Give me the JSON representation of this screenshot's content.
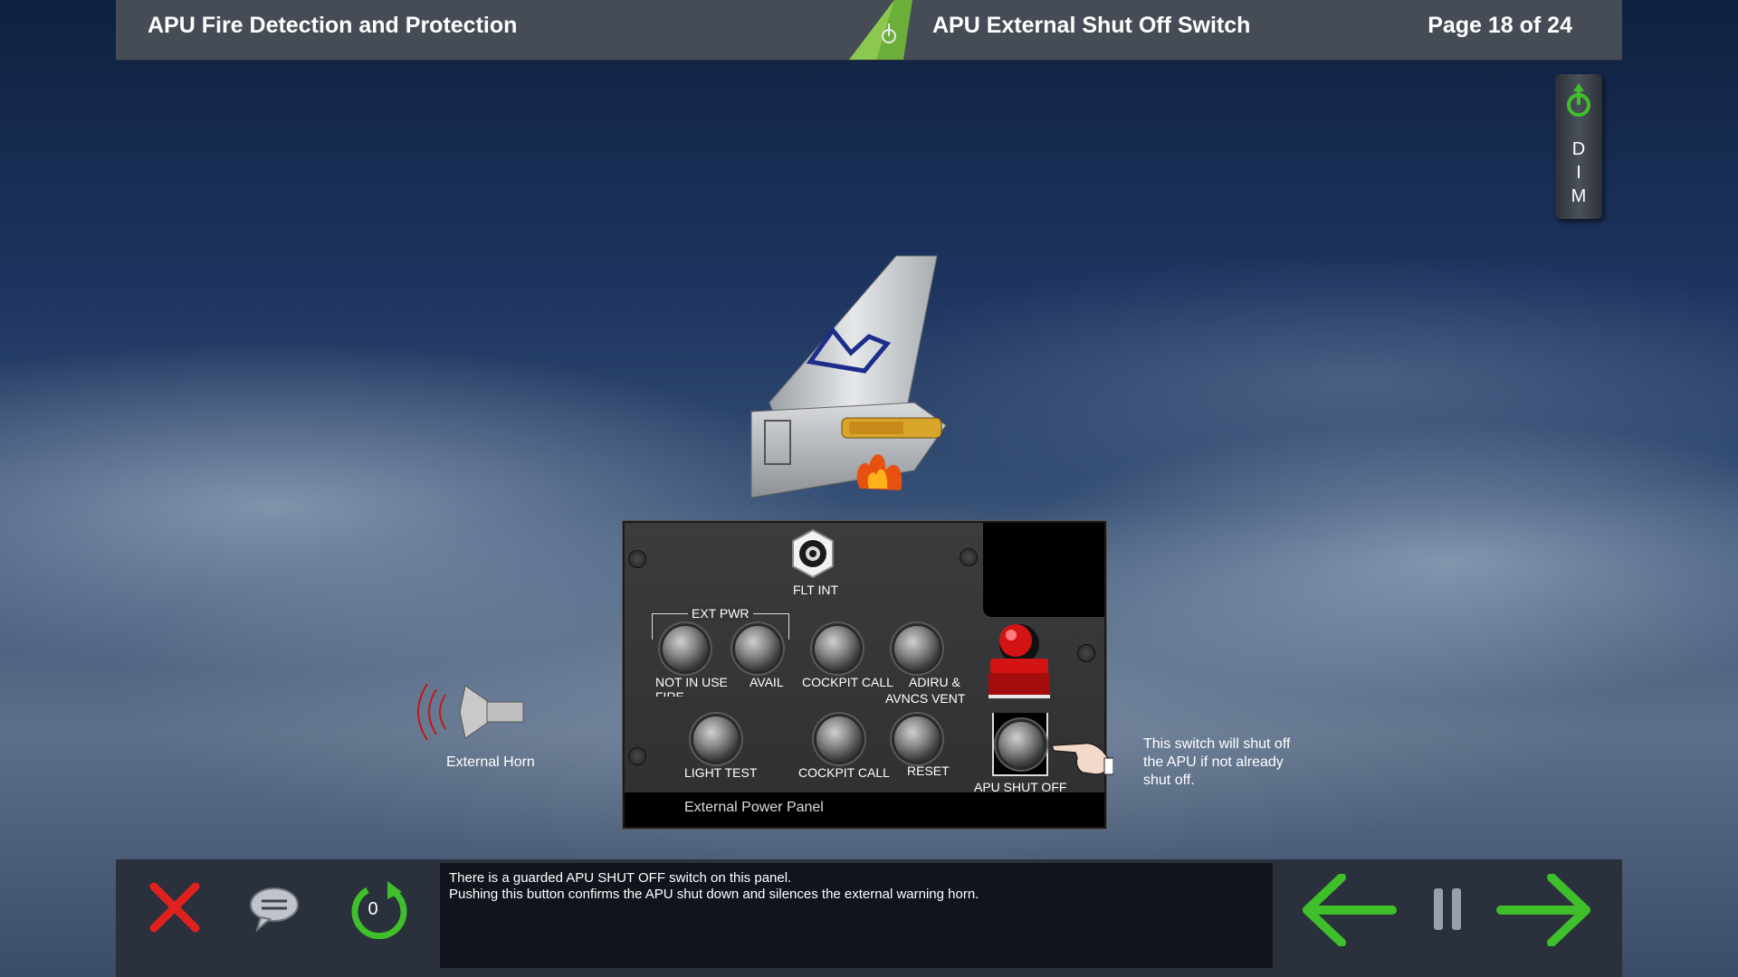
{
  "header": {
    "course_title": "APU Fire Detection and Protection",
    "page_title": "APU External Shut Off Switch",
    "page_indicator": "Page 18 of 24"
  },
  "dim_button": {
    "letters": [
      "D",
      "I",
      "M"
    ],
    "icon": "power-icon"
  },
  "panel": {
    "flt_int_label": "FLT INT",
    "ext_pwr_label": "EXT PWR",
    "not_in_use_label": "NOT IN USE",
    "not_in_use_sub": "FIRE",
    "avail_label": "AVAIL",
    "cockpit_call_top_label": "COCKPIT CALL",
    "adiru_label_1": "ADIRU &",
    "adiru_label_2": "AVNCS VENT",
    "light_test_label": "LIGHT TEST",
    "cockpit_call_bottom_label": "COCKPIT CALL",
    "reset_label": "RESET",
    "apu_shut_off_label": "APU SHUT OFF",
    "footer_label": "External Power Panel"
  },
  "horn": {
    "label": "External Horn"
  },
  "callout": {
    "text": "This switch will shut off the APU if not already shut off."
  },
  "message": {
    "line1": "There is a guarded APU SHUT OFF switch on this panel.",
    "line2": "Pushing this button confirms the APU shut down and silences the external warning horn."
  },
  "controls": {
    "replay_count": "0",
    "close_icon": "close-icon",
    "comment_icon": "speech-bubble-icon",
    "replay_icon": "replay-icon",
    "back_icon": "arrow-left-icon",
    "pause_icon": "pause-icon",
    "next_icon": "arrow-right-icon"
  },
  "colors": {
    "accent_green": "#3fbf2a",
    "close_red": "#e0221f",
    "header_bg": "#454c56"
  }
}
